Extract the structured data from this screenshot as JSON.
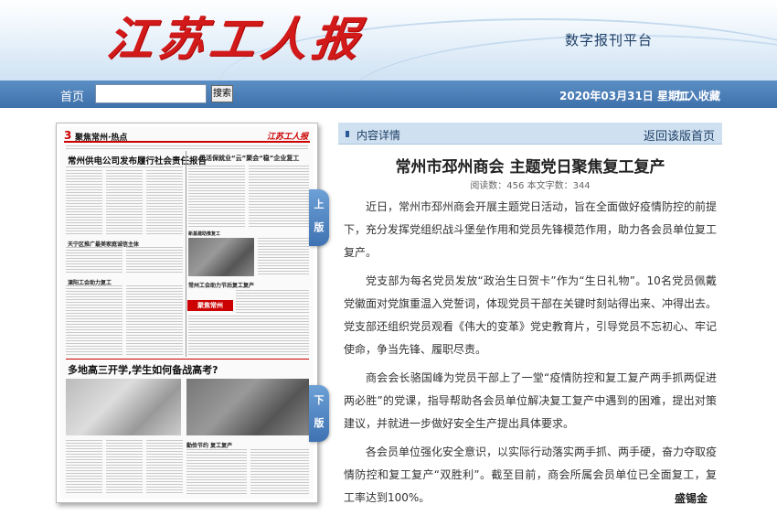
{
  "header": {
    "logo_text": "江苏工人报",
    "platform_title": "数字报刊平台"
  },
  "nav": {
    "home_label": "首页",
    "search_value": "",
    "search_button_label": "搜索",
    "date_text": "2020年03月31日 星期二",
    "favorite_label": "加入收藏"
  },
  "newspaper_page": {
    "page_number": "3",
    "section_name": "聚焦常州·热点",
    "masthead": "江苏工人报",
    "headlines": [
      "常州供电公司发布履行社会责任报告",
      "灵活保就业“云”聚会“稳”企业复工",
      "多地高三开学,学生如何备战高考?",
      "天宁区推广最美家庭诚信主体",
      "溧阳工会助力复工",
      "常州工会助力节后复工复产",
      "勤俭节约 复工复产",
      "新基建助推复工"
    ],
    "tag_label": "聚焦常州"
  },
  "version_nav": {
    "prev_chars": [
      "上",
      "版"
    ],
    "next_chars": [
      "下",
      "版"
    ]
  },
  "article": {
    "section_label": "内容详情",
    "back_link_label": "返回该版首页",
    "title": "常州市邳州商会 主题党日聚焦复工复产",
    "meta": "阅读数：456   本文字数：344",
    "paragraphs": [
      "近日，常州市邳州商会开展主题党日活动，旨在全面做好疫情防控的前提下，充分发挥党组织战斗堡垒作用和党员先锋模范作用，助力各会员单位复工复产。",
      "党支部为每名党员发放“政治生日贺卡”作为“生日礼物”。10名党员佩戴党徽面对党旗重温入党誓词，体现党员干部在关键时刻站得出来、冲得出去。党支部还组织党员观看《伟大的变革》党史教育片，引导党员不忘初心、牢记使命，争当先锋、履职尽责。",
      "商会会长骆国峰为党员干部上了一堂“疫情防控和复工复产两手抓两促进两必胜”的党课，指导帮助各会员单位解决复工复产中遇到的困难，提出对策建议，并就进一步做好安全生产提出具体要求。",
      "各会员单位强化安全意识，以实际行动落实两手抓、两手硬，奋力夺取疫情防控和复工复产“双胜利”。截至目前，商会所属会员单位已全面复工，复工率达到100%。"
    ],
    "author": "盛锡金"
  },
  "colors": {
    "logo_red": "#d21a1a",
    "nav_blue": "#3d6fa9",
    "panel_bar": "#cfe0f0"
  }
}
